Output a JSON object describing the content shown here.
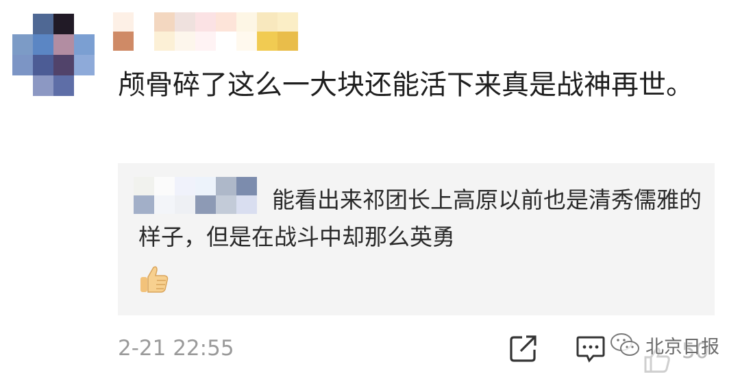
{
  "comment": {
    "text": "颅骨碎了这么一大块还能活下来真是战神再世。",
    "timestamp": "2-21 22:55"
  },
  "reply": {
    "text": "能看出来祁团长上高原以前也是清秀儒雅的样子，但是在战斗中却那么英勇",
    "emoji": "thumbs-up"
  },
  "actions": {
    "share_icon": "share-icon",
    "reply_icon": "comment-icon",
    "like_icon": "thumbs-up-icon",
    "like_count": "50"
  },
  "watermark": {
    "text": "北京日报",
    "icon": "wechat-icon"
  },
  "colors": {
    "reply_background": "#f4f4f4",
    "meta_text": "#9a9a9a"
  }
}
